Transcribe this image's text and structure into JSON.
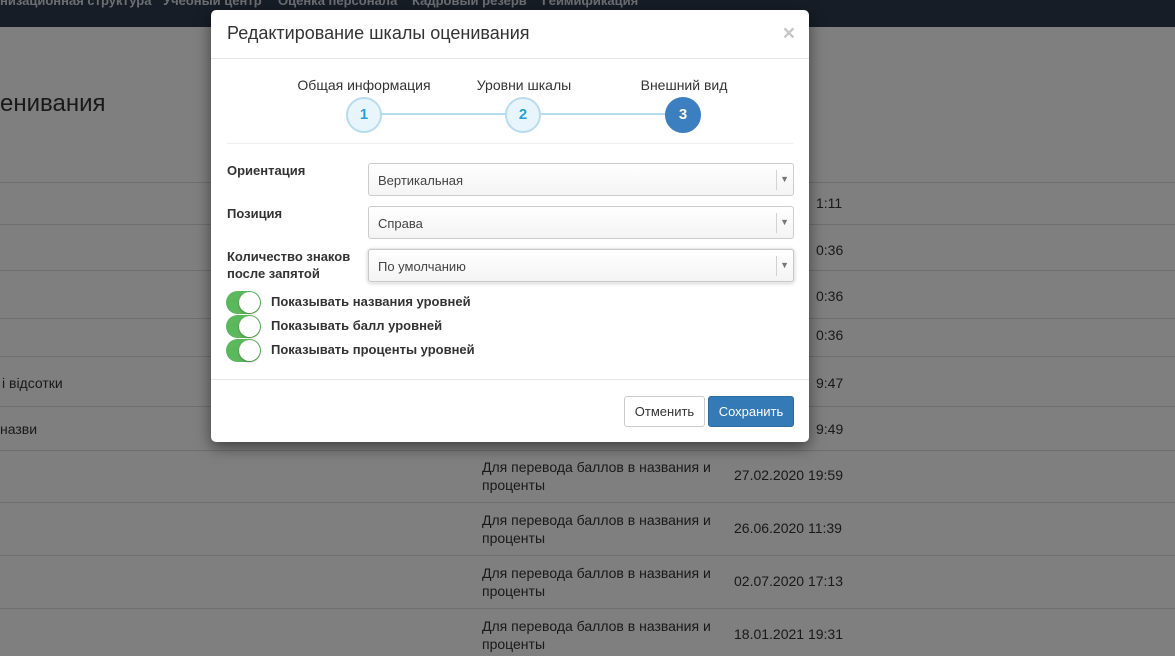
{
  "topnav": {
    "items": [
      "низационная структура",
      "Учебный центр",
      "Оценка персонала",
      "Кадровый резерв",
      "Геймификация"
    ]
  },
  "page": {
    "title": "енивания"
  },
  "table": {
    "rows": [
      {
        "name": "",
        "description": "",
        "time": "1:11"
      },
      {
        "name": "",
        "description": "",
        "time": "0:36"
      },
      {
        "name": "",
        "description": "",
        "time": "0:36"
      },
      {
        "name": "",
        "description": "",
        "time": "0:36"
      },
      {
        "name": "і відсотки",
        "description": "",
        "time": "9:47"
      },
      {
        "name": "назви",
        "description": "",
        "time": "9:49"
      },
      {
        "name": "",
        "description": "Для перевода баллов в названия и проценты",
        "time": "27.02.2020 19:59"
      },
      {
        "name": "",
        "description": "Для перевода баллов в названия и проценты",
        "time": "26.06.2020 11:39"
      },
      {
        "name": "",
        "description": "Для перевода баллов в названия и проценты",
        "time": "02.07.2020 17:13"
      },
      {
        "name": "",
        "description": "Для перевода баллов в названия и проценты",
        "time": "18.01.2021 19:31"
      }
    ]
  },
  "modal": {
    "title": "Редактирование шкалы оценивания",
    "close_glyph": "×",
    "steps": [
      {
        "label": "Общая информация",
        "number": "1"
      },
      {
        "label": "Уровни шкалы",
        "number": "2"
      },
      {
        "label": "Внешний вид",
        "number": "3"
      }
    ],
    "active_step": 3,
    "fields": {
      "orientation": {
        "label": "Ориентация",
        "value": "Вертикальная"
      },
      "position": {
        "label": "Позиция",
        "value": "Справа"
      },
      "decimals": {
        "label_line1": "Количество знаков",
        "label_line2": "после запятой",
        "value": "По умолчанию"
      }
    },
    "dropdown_arrow": "▼",
    "toggles": [
      {
        "label": "Показывать названия уровней",
        "checked": true
      },
      {
        "label": "Показывать балл уровней",
        "checked": true
      },
      {
        "label": "Показывать проценты уровней",
        "checked": true
      }
    ],
    "buttons": {
      "cancel": "Отменить",
      "save": "Сохранить"
    }
  },
  "colors": {
    "navbar": "#2c3b4d",
    "toggle_on": "#5cb85c",
    "primary": "#337ab7",
    "step_active": "#3c7fc0",
    "step_inactive_border": "#b8dcef"
  }
}
